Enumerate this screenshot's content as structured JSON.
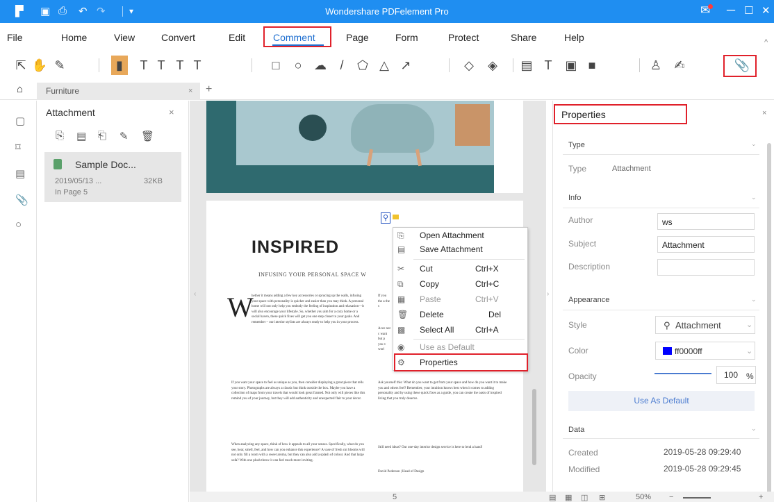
{
  "app": {
    "title": "Wondershare PDFelement Pro",
    "quick_access": [
      "▣",
      "⎙",
      "↶",
      "↷",
      "▾"
    ],
    "window_controls": [
      "✉",
      "─",
      "☐",
      "✕"
    ]
  },
  "menu": {
    "items": [
      "File",
      "Home",
      "View",
      "Convert",
      "Edit",
      "Comment",
      "Page",
      "Form",
      "Protect",
      "Share",
      "Help"
    ],
    "active": "Comment",
    "caret": "^"
  },
  "toolbar": {
    "icons": [
      "select-tool-icon",
      "hand-tool-icon",
      "note-icon",
      "highlight-icon",
      "strikethrough-icon",
      "underline-icon",
      "squiggly-icon",
      "replace-text-icon",
      "rectangle-icon",
      "oval-icon",
      "cloud-icon",
      "line-icon",
      "polygon-icon",
      "polyline-icon",
      "arrow-icon",
      "pencil-icon",
      "eraser-icon",
      "text-comment-icon",
      "typewriter-icon",
      "textbox-icon",
      "area-highlight-icon",
      "stamp-icon",
      "signature-icon",
      "attachment-icon"
    ],
    "glyphs": [
      "⇱",
      "✋",
      "✎",
      "▮",
      "T",
      "T",
      "T",
      "T",
      "□",
      "○",
      "☁",
      "/",
      "⬠",
      "△",
      "↗",
      "◇",
      "◈",
      "▤",
      "T",
      "▣",
      "■",
      "♙",
      "✍",
      "📎"
    ]
  },
  "tabs": {
    "file_tab": "Furniture",
    "close": "×",
    "add": "+"
  },
  "rail": {
    "icons": [
      "pages-icon",
      "bookmark-icon",
      "comment-icon",
      "attachment-icon",
      "search-icon"
    ],
    "glyphs": [
      "▢",
      "⌑",
      "▤",
      "📎",
      "○"
    ]
  },
  "attachment_panel": {
    "title": "Attachment",
    "close": "×",
    "tools": [
      "⎘",
      "▤",
      "⎗",
      "✎",
      "🗑"
    ],
    "item": {
      "name": "Sample Doc...",
      "date": "2019/05/13 ...",
      "size": "32KB",
      "page": "In Page 5"
    }
  },
  "document": {
    "headline": "INSPIRED",
    "subline": "INFUSING YOUR PERSONAL SPACE W",
    "dropcap": "W",
    "col1_para1": "hether it means adding a few key accessories or sprucing up the walls, infusing your space with personality is quicker and easier than you may think. A personal home will not only help you embody the feeling of inspiration and relaxation—it will also encourage your lifestyle. So, whether you aim for a cozy home or a social haven, these quick fixes will get you one step closer to your goals. And remember – our interior stylists are always ready to help you in your process.",
    "col1_para2": "If you want your space to feel as unique as you, then consider displaying a great piece that tells your story. Photographs are always a classic but think outside the box. Maybe you have a collection of maps from your travels that would look great framed. Not only will pieces like this remind you of your journey, but they will add authenticity and unexpected flair to your decor.",
    "col1_para3": "When analyzing any space, think of how it appeals to all your senses. Specifically, what do you see, hear, smell, feel, and how can you enhance this experience? A vase of fresh cut blooms will not only fill a room with a sweet aroma, but they can also add a splash of colour. And that large sofa? With one plush throw it can feel much more inviting.",
    "col2_para1": "If you the a the s",
    "col2_para2": "Acce not c want but p you v worl",
    "col2_para3": "Ask yourself this: What do you want to get from your space and how do you want it to make you and others feel? Remember, your intuition knows best when it comes to adding personality and by using these quick fixes as a guide, you can create the oasis of inspired living that you truly deserve.",
    "col2_para4": "Still need ideas? Our one-day interior design service is here to lend a hand!",
    "col2_sign": "David Pedersen | Head of Design"
  },
  "context_menu": {
    "items": [
      {
        "label": "Open Attachment",
        "shortcut": "",
        "disabled": false,
        "icon": "open-attachment-icon",
        "glyph": "⎘"
      },
      {
        "label": "Save Attachment",
        "shortcut": "",
        "disabled": false,
        "icon": "save-attachment-icon",
        "glyph": "▤"
      },
      {
        "label": "Cut",
        "shortcut": "Ctrl+X",
        "disabled": false,
        "icon": "cut-icon",
        "glyph": "✂"
      },
      {
        "label": "Copy",
        "shortcut": "Ctrl+C",
        "disabled": false,
        "icon": "copy-icon",
        "glyph": "⧉"
      },
      {
        "label": "Paste",
        "shortcut": "Ctrl+V",
        "disabled": true,
        "icon": "paste-icon",
        "glyph": "▦"
      },
      {
        "label": "Delete",
        "shortcut": "Del",
        "disabled": false,
        "icon": "delete-icon",
        "glyph": "🗑"
      },
      {
        "label": "Select All",
        "shortcut": "Ctrl+A",
        "disabled": false,
        "icon": "select-all-icon",
        "glyph": "▩"
      },
      {
        "label": "Use as Default",
        "shortcut": "",
        "disabled": true,
        "icon": "use-default-icon",
        "glyph": "◉"
      },
      {
        "label": "Properties",
        "shortcut": "",
        "disabled": false,
        "icon": "properties-icon",
        "glyph": "⚙"
      }
    ]
  },
  "properties": {
    "title": "Properties",
    "close": "×",
    "type_section": "Type",
    "type_label": "Type",
    "type_value": "Attachment",
    "info_section": "Info",
    "author_label": "Author",
    "author_value": "ws",
    "subject_label": "Subject",
    "subject_value": "Attachment",
    "description_label": "Description",
    "description_value": "",
    "appearance_section": "Appearance",
    "style_label": "Style",
    "style_value": "Attachment",
    "style_icon": "⚲",
    "color_label": "Color",
    "color_value": "ff0000ff",
    "opacity_label": "Opacity",
    "opacity_value": "100",
    "opacity_unit": "%",
    "use_default": "Use As Default",
    "data_section": "Data",
    "created_label": "Created",
    "created_value": "2019-05-28 09:29:40",
    "modified_label": "Modified",
    "modified_value": "2019-05-28 09:29:45",
    "caret": "⌄"
  },
  "statusbar": {
    "page": "5",
    "zoom": "50%",
    "view_icons": [
      "single-page-icon",
      "continuous-icon",
      "two-page-icon",
      "grid-icon"
    ],
    "view_glyphs": [
      "▤",
      "▦",
      "◫",
      "⊞"
    ],
    "zoom_minus": "−",
    "zoom_plus": "+"
  },
  "colors": {
    "titlebar": "#1f8ef1",
    "accent": "#4a7bd0",
    "highlight_box": "#e0202a",
    "annotation_color": "#0000ff"
  }
}
